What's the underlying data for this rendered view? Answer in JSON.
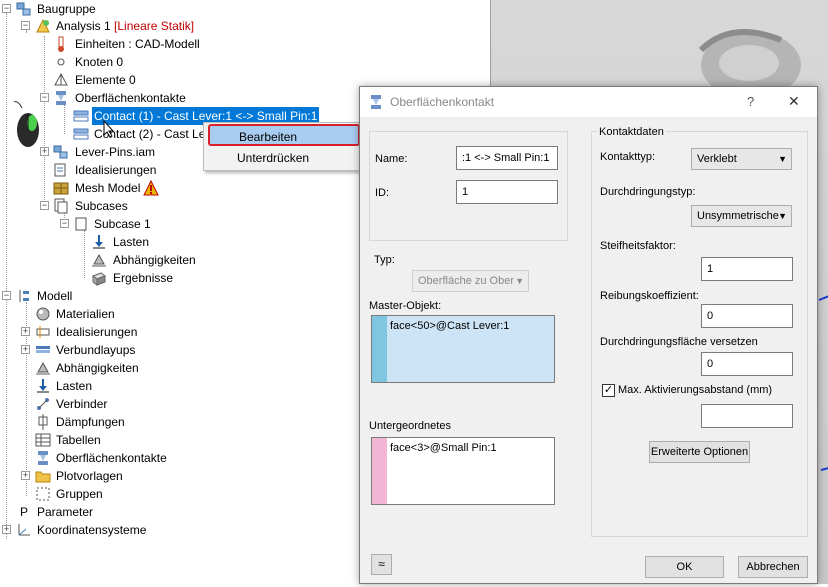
{
  "tree": {
    "baugruppe": "Baugruppe",
    "analysis": "Analysis 1",
    "analysis_type": "[Lineare Statik]",
    "einheiten": "Einheiten : CAD-Modell",
    "knoten": "Knoten 0",
    "elemente": "Elemente 0",
    "oberflaechenkontakte": "Oberflächenkontakte",
    "contact1": "Contact (1) - Cast Lever:1 <-> Small Pin:1",
    "contact2": "Contact (2) - Cast Le",
    "lever_pins": "Lever-Pins.iam",
    "idealisierungen": "Idealisierungen",
    "mesh_model": "Mesh Model",
    "subcases": "Subcases",
    "subcase1": "Subcase 1",
    "lasten": "Lasten",
    "abhaengigkeiten": "Abhängigkeiten",
    "ergebnisse": "Ergebnisse",
    "modell": "Modell",
    "materialien": "Materialien",
    "m_idealisierungen": "Idealisierungen",
    "verbundlayups": "Verbundlayups",
    "m_abhaengigkeiten": "Abhängigkeiten",
    "m_lasten": "Lasten",
    "verbinder": "Verbinder",
    "daempfungen": "Dämpfungen",
    "tabellen": "Tabellen",
    "m_oberflaechenkontakte": "Oberflächenkontakte",
    "plotvorlagen": "Plotvorlagen",
    "gruppen": "Gruppen",
    "parameter": "Parameter",
    "koordinatensysteme": "Koordinatensysteme"
  },
  "context_menu": {
    "edit": "Bearbeiten",
    "suppress": "Unterdrücken"
  },
  "dialog": {
    "title": "Oberflächenkontakt",
    "help": "?",
    "close": "✕",
    "name_label": "Name:",
    "name_value": ":1 <-> Small Pin:1",
    "id_label": "ID:",
    "id_value": "1",
    "typ_label": "Typ:",
    "typ_value": "Oberfläche zu Ober",
    "master_label": "Master-Objekt:",
    "master_item": "face<50>@Cast Lever:1",
    "slave_label": "Untergeordnetes",
    "slave_item": "face<3>@Small Pin:1",
    "contact_group": "Kontaktdaten",
    "kontakttyp_label": "Kontakttyp:",
    "kontakttyp_value": "Verklebt",
    "durchdringungstyp_label": "Durchdringungstyp:",
    "durchdringungstyp_value": "Unsymmetrische",
    "steifheit_label": "Steifheitsfaktor:",
    "steifheit_value": "1",
    "reibung_label": "Reibungskoeffizient:",
    "reibung_value": "0",
    "versetzen_label": "Durchdringungsfläche versetzen",
    "versetzen_value": "0",
    "max_label": "Max. Aktivierungsabstand (mm)",
    "max_value": "",
    "advanced_button": "Erweiterte Optionen",
    "ok_button": "OK",
    "cancel_button": "Abbrechen",
    "collapse_button": "≈"
  },
  "colors": {
    "selection": "#0078d7",
    "master_swatch": "#7fc6e0",
    "slave_swatch": "#f2b6d4",
    "highlight_border": "#d9212a"
  }
}
